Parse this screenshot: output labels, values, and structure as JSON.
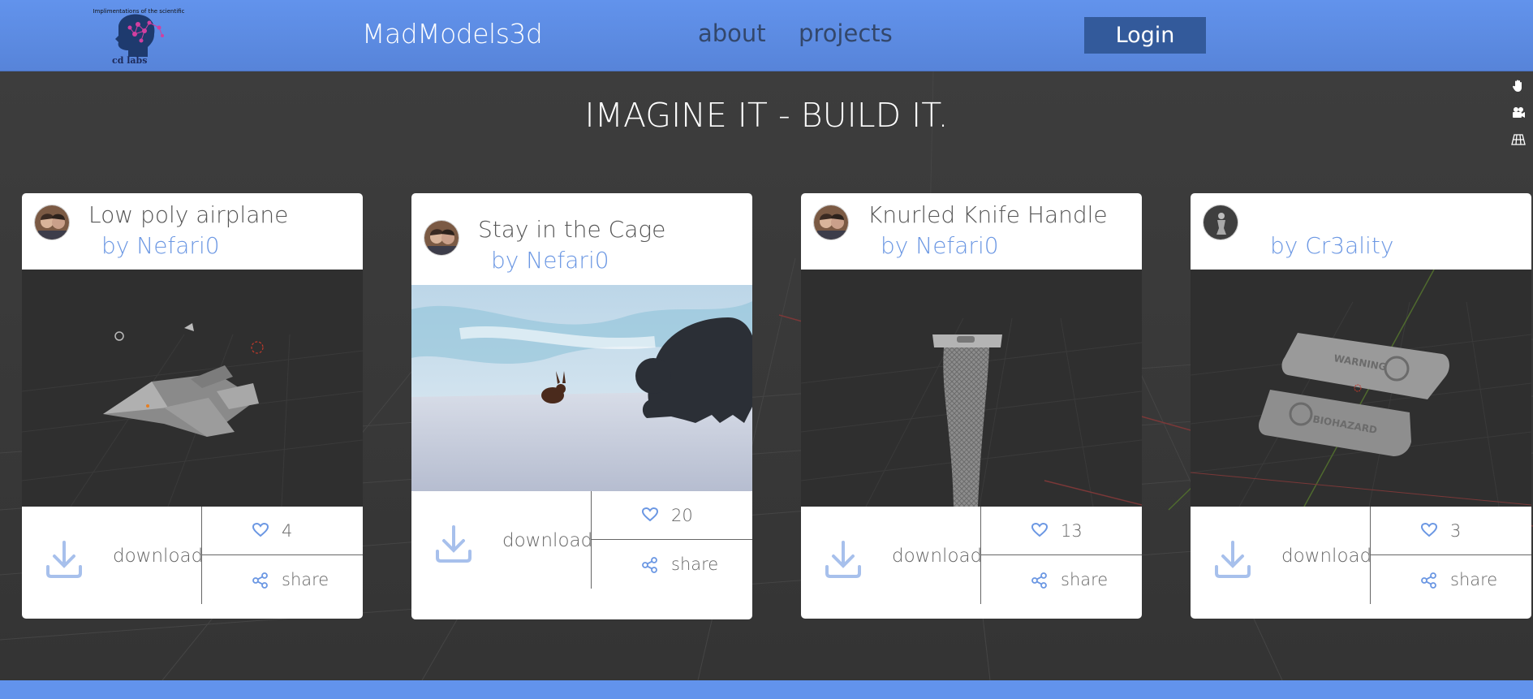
{
  "header": {
    "logo_caption": "Implimentations of the scientific",
    "logo_footer": "cd labs",
    "brand": "MadModels3d",
    "nav": [
      {
        "label": "about"
      },
      {
        "label": "projects"
      }
    ],
    "login_label": "Login"
  },
  "tools": [
    {
      "icon": "hand-icon"
    },
    {
      "icon": "camera-icon"
    },
    {
      "icon": "grid-icon"
    }
  ],
  "headline": "IMAGINE IT - BUILD IT.",
  "cards": [
    {
      "title": "Low poly airplane",
      "author": "by Nefari0",
      "download_label": "download",
      "likes": "4",
      "share_label": "share"
    },
    {
      "title": "Stay in the Cage",
      "author": "by Nefari0",
      "download_label": "download",
      "likes": "20",
      "share_label": "share"
    },
    {
      "title": "Knurled Knife Handle",
      "author": "by Nefari0",
      "download_label": "download",
      "likes": "13",
      "share_label": "share"
    },
    {
      "title": "",
      "author": "by Cr3ality",
      "download_label": "download",
      "likes": "3",
      "share_label": "share",
      "image_text": [
        "WARNING",
        "BIOHAZARD"
      ]
    }
  ],
  "colors": {
    "header": "#6293ec",
    "accent": "#6b97e3",
    "login": "#335a9b",
    "nav": "#33476b"
  }
}
